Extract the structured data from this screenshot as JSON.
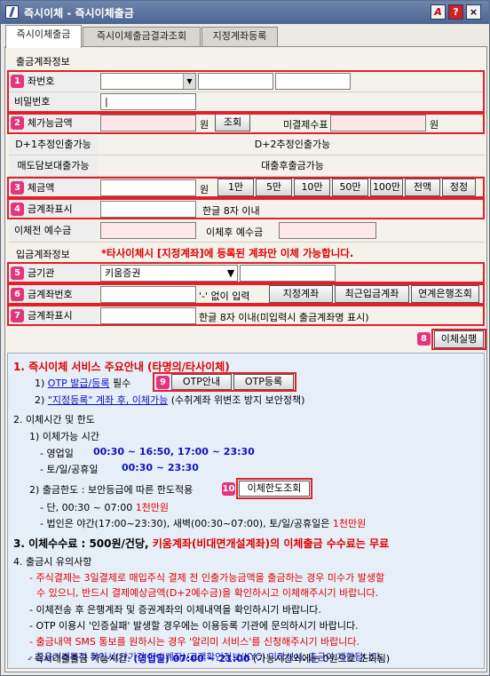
{
  "window": {
    "title": "즉시이체 - 즉시이체출금"
  },
  "titlebar_buttons": {
    "font": "A",
    "help": "?",
    "close": "×"
  },
  "tabs": [
    {
      "label": "즉시이체출금"
    },
    {
      "label": "즉시이체출금결과조회"
    },
    {
      "label": "지정계좌등록"
    }
  ],
  "withdraw": {
    "section": "출금계좌정보",
    "account_label": "좌번호",
    "password_label": "비밀번호",
    "password_value": "|",
    "available_label": "체가능금액",
    "won": "원",
    "query_button": "조회",
    "uncleared_label": "미결제수표",
    "d1_label": "D+1추정인출가능",
    "d2_label": "D+2추정인출가능",
    "secured_label": "매도담보대출가능",
    "after_loan_label": "대출후출금가능"
  },
  "amount": {
    "label": "체금액",
    "won": "원",
    "quick_buttons": [
      "1만",
      "5만",
      "10만",
      "50만",
      "100만",
      "전액",
      "정정"
    ],
    "display_label": "금계좌표시",
    "display_hint": "한글 8자 이내",
    "before_label": "이체전 예수금",
    "after_label": "이체후 예수금"
  },
  "deposit": {
    "section": "입금계좌정보",
    "warning": "*타사이체시 [지정계좌]에 등록된 계좌만 이체 가능합니다.",
    "bank_label": "금기관",
    "bank_value": "키움증권",
    "account_label": "금계좌번호",
    "account_hint": "'-' 없이 입력",
    "designated_button": "지정계좌",
    "recent_button": "최근입금계좌",
    "linked_button": "연계은행조회",
    "display_label": "금계좌표시",
    "display_hint": "한글 8자 이내(미입력시 출금계좌명 표시)"
  },
  "execute_button": "이체실행",
  "badges": [
    "1",
    "2",
    "3",
    "4",
    "5",
    "6",
    "7",
    "8",
    "9",
    "10"
  ],
  "notice": {
    "s1_title": "1. 즉시이체 서비스 주요안내 (타명의/타사이체)",
    "s1_1_prefix": "1) ",
    "s1_1_link": "OTP 발급/등록",
    "s1_1_suffix": " 필수",
    "otp_info_button": "OTP안내",
    "otp_register_button": "OTP등록",
    "s1_2_prefix": "2) ",
    "s1_2_link": "\"지정등록\" 계좌 후, 이체가능",
    "s1_2_suffix": " (수취계좌 위변조 방지 보안정책)",
    "s2_title": "2. 이체시간 및 한도",
    "s2_1": "1) 이체가능 시간",
    "s2_1_a_label": "- 영업일",
    "s2_1_a_time": "00:30 ~ 16:50, 17:00 ~ 23:30",
    "s2_1_b_label": "- 토/일/공휴일",
    "s2_1_b_time": "00:30 ~ 23:30",
    "s2_2": "2) 출금한도 : 보안등급에 따른 한도적용",
    "limit_button": "이체한도조회",
    "s2_2_a_prefix": "- 단, 00:30 ~ 07:00 ",
    "s2_2_a_red": "1천만원",
    "s2_2_b_prefix": "- 법인은 야간(17:00~23:30), 새벽(00:30~07:00), 토/일/공휴일은 ",
    "s2_2_b_red": "1천만원",
    "s3_prefix": "3. 이체수수료 : 500원/건당, ",
    "s3_red": "키움계좌(비대면개설계좌)의 이체출금 수수료는 무료",
    "s4_title": "4. 출금시 유의사항",
    "s4_1a": "- 주식결제는 3일결제로 매입주식 결제 전 인출가능금액을 출금하는 경우 미수가 발생할",
    "s4_1b": "수 있으니, 반드시 결제예상금액(D+2예수금)을 확인하시고 이체해주시기 바랍니다.",
    "s4_2": "- 이체전송 후 은행계좌 및 증권계좌의 이체내역을 확인하시기 바랍니다.",
    "s4_3": "- OTP 이용시 '인증실패' 발생할 경우에는 이용등록 기관에 문의하시기 바랍니다.",
    "s4_4": "- 출금내역 SMS 통보를 원하시는 경우 '알리미 서비스'를 신청해주시기 바랍니다.",
    "s4_5": "- 금융거래목적 확인서(단기간 다수계좌)/고객확인정보(KYC) 미작성시, 출금이 제한됩니다.",
    "s4_6_prefix": "- 즉시대출출금 가능시간: ",
    "s4_6_blue": "(영업일) 07:00 ~ 21:00",
    "s4_6_suffix": " (가능시간외에는 0원으로 조회됨)"
  }
}
